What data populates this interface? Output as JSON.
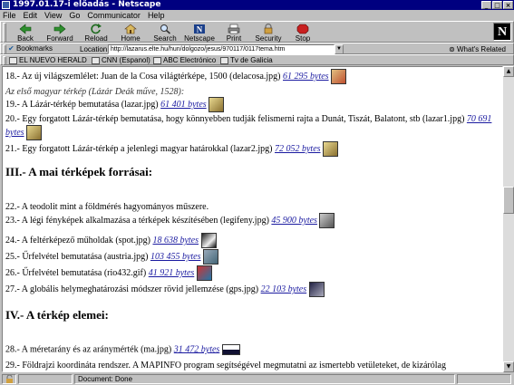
{
  "window": {
    "title": "1997.01.17-i előadás - Netscape",
    "min": "_",
    "max": "□",
    "close": "×"
  },
  "menu": [
    "File",
    "Edit",
    "View",
    "Go",
    "Communicator",
    "Help"
  ],
  "toolbar": [
    {
      "label": "Back",
      "icon": "back-arrow-icon"
    },
    {
      "label": "Forward",
      "icon": "forward-arrow-icon"
    },
    {
      "label": "Reload",
      "icon": "reload-icon"
    },
    {
      "label": "Home",
      "icon": "home-icon"
    },
    {
      "label": "Search",
      "icon": "search-icon"
    },
    {
      "label": "Netscape",
      "icon": "netscape-icon"
    },
    {
      "label": "Print",
      "icon": "print-icon"
    },
    {
      "label": "Security",
      "icon": "security-lock-icon"
    },
    {
      "label": "Stop",
      "icon": "stop-icon"
    }
  ],
  "logo": "N",
  "location": {
    "bookmarks_label": "Bookmarks",
    "location_label": "Location:",
    "url": "http://lazarus.elte.hu/hun/dolgozo/jesus/970117/0117tema.htm",
    "related_label": "What's Related"
  },
  "personal_bar": [
    "EL NUEVO HERALD",
    "CNN (Espanol)",
    "ABC Electrónico",
    "Tv de Galicia"
  ],
  "content": {
    "item18": {
      "text": "18.- Az új világszemlélet: Juan de la Cosa világtérképe, 1500 (delacosa.jpg)",
      "link": "61 295 bytes"
    },
    "first_hu_map": "Az első magyar térkép (Lázár Deák műve, 1528):",
    "item19": {
      "text": "19.- A Lázár-térkép bemutatása (lazar.jpg)",
      "link": "61 401 bytes"
    },
    "item20": {
      "text": "20.- Egy forgatott Lázár-térkép bemutatása, hogy könnyebben tudják felismerni rajta a Dunát, Tiszát, Balatont, stb (lazar1.jpg)",
      "link": "70 691 bytes"
    },
    "item21": {
      "text": "21.- Egy forgatott Lázár-térkép a jelenlegi magyar határokkal (lazar2.jpg)",
      "link": "72 052 bytes"
    },
    "section3": "III.- A mai térképek forrásai:",
    "item22": {
      "text": "22.- A teodolit mint a földmérés hagyományos műszere."
    },
    "item23": {
      "text": "23.- A légi fényképek alkalmazása a térképek készítésében (legifeny.jpg)",
      "link": "45 900 bytes"
    },
    "item24": {
      "text": "24.- A feltérképező műholdak (spot.jpg)",
      "link": "18 638 bytes"
    },
    "item25": {
      "text": "25.- Űrfelvétel bemutatása (austria.jpg)",
      "link": "103 455 bytes"
    },
    "item26": {
      "text": "26.- Űrfelvétel bemutatása (rio432.gif)",
      "link": "41 921 bytes"
    },
    "item27": {
      "text": "27.- A globális helymeghatározási módszer rövid jellemzése (gps.jpg)",
      "link": "22 103 bytes"
    },
    "section4": "IV.- A térkép elemei:",
    "item28": {
      "text": "28.- A méretarány és az aránymérték (ma.jpg)",
      "link": "31 472 bytes"
    },
    "item29": {
      "text": "29.- Földrajzi koordináta rendszer. A MAPINFO program segítségével megmutatni az ismertebb vetületeket, de kizárólag"
    }
  },
  "status": {
    "text": "Document: Done"
  },
  "colors": {
    "titlebar": "#000080",
    "link": "#1a1aa0",
    "chrome": "#c0c0c0"
  }
}
